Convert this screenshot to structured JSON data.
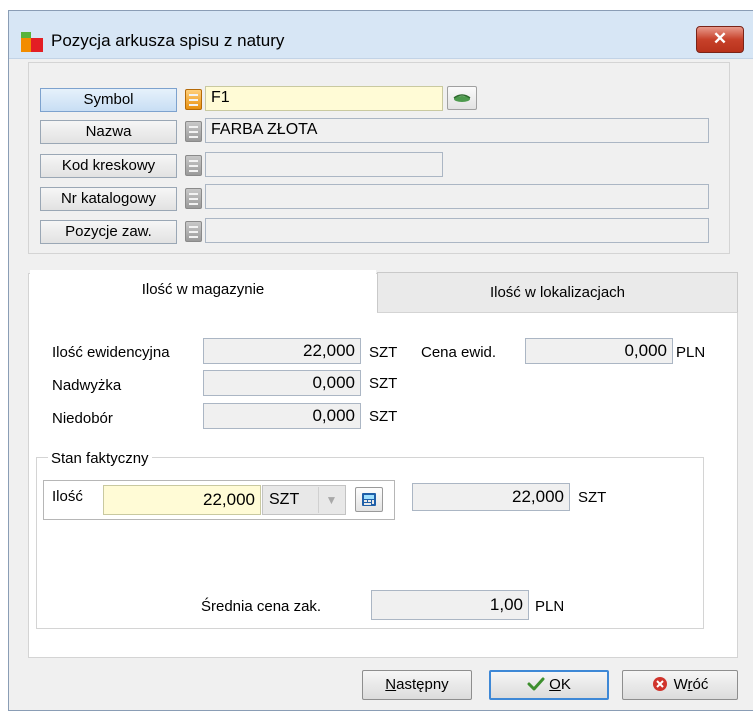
{
  "window": {
    "title": "Pozycja arkusza spisu z natury"
  },
  "fields": {
    "symbol": {
      "label": "Symbol",
      "value": "F1"
    },
    "nazwa": {
      "label": "Nazwa",
      "value": "FARBA ZŁOTA"
    },
    "kod": {
      "label": "Kod kreskowy",
      "value": ""
    },
    "katalog": {
      "label": "Nr katalogowy",
      "value": ""
    },
    "pozycje": {
      "label": "Pozycje zaw.",
      "value": ""
    }
  },
  "tabs": [
    {
      "label": "Ilość w magazynie",
      "active": true
    },
    {
      "label": "Ilość w lokalizacjach",
      "active": false
    }
  ],
  "stock": {
    "ewid_label": "Ilość ewidencyjna",
    "ewid_value": "22,000",
    "ewid_unit": "SZT",
    "cena_label": "Cena ewid.",
    "cena_value": "0,000",
    "cena_unit": "PLN",
    "nadwyzka_label": "Nadwyżka",
    "nadwyzka_value": "0,000",
    "nadwyzka_unit": "SZT",
    "niedobor_label": "Niedobór",
    "niedobor_value": "0,000",
    "niedobor_unit": "SZT"
  },
  "actual": {
    "group_label": "Stan faktyczny",
    "ilosc_label": "Ilość",
    "ilosc_value": "22,000",
    "unit_select": "SZT",
    "converted_value": "22,000",
    "converted_unit": "SZT",
    "cena_label": "Średnia cena zak.",
    "cena_value": "1,00",
    "cena_unit": "PLN"
  },
  "buttons": {
    "next_prefix": "",
    "next_underline": "N",
    "next_rest": "astępny",
    "ok_underline": "O",
    "ok_rest": "K",
    "back_prefix": "W",
    "back_underline": "r",
    "back_rest": "óć"
  },
  "colors": {
    "title_bg": "#d7e6f5",
    "highlight_field": "#fffbd6",
    "ok_border": "#3e88d6",
    "close_red": "#c7412a"
  }
}
